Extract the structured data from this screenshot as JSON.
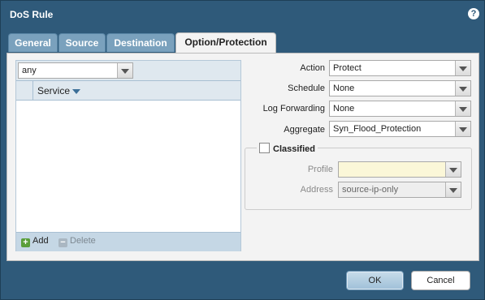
{
  "dialog": {
    "title": "DoS Rule",
    "help_icon": "?"
  },
  "tabs": [
    {
      "label": "General",
      "active": false
    },
    {
      "label": "Source",
      "active": false
    },
    {
      "label": "Destination",
      "active": false
    },
    {
      "label": "Option/Protection",
      "active": true
    }
  ],
  "service": {
    "filter_value": "any",
    "column_header": "Service",
    "add_label": "Add",
    "delete_label": "Delete"
  },
  "form": {
    "action_label": "Action",
    "action_value": "Protect",
    "schedule_label": "Schedule",
    "schedule_value": "None",
    "log_forwarding_label": "Log Forwarding",
    "log_forwarding_value": "None",
    "aggregate_label": "Aggregate",
    "aggregate_value": "Syn_Flood_Protection"
  },
  "classified": {
    "label": "Classified",
    "checked": false,
    "profile_label": "Profile",
    "profile_value": "",
    "address_label": "Address",
    "address_value": "source-ip-only"
  },
  "buttons": {
    "ok": "OK",
    "cancel": "Cancel"
  },
  "colors": {
    "titlebar": "#2f5a7a",
    "tab_inactive": "#7aa1bd",
    "panel_bg": "#f3f3f3"
  }
}
